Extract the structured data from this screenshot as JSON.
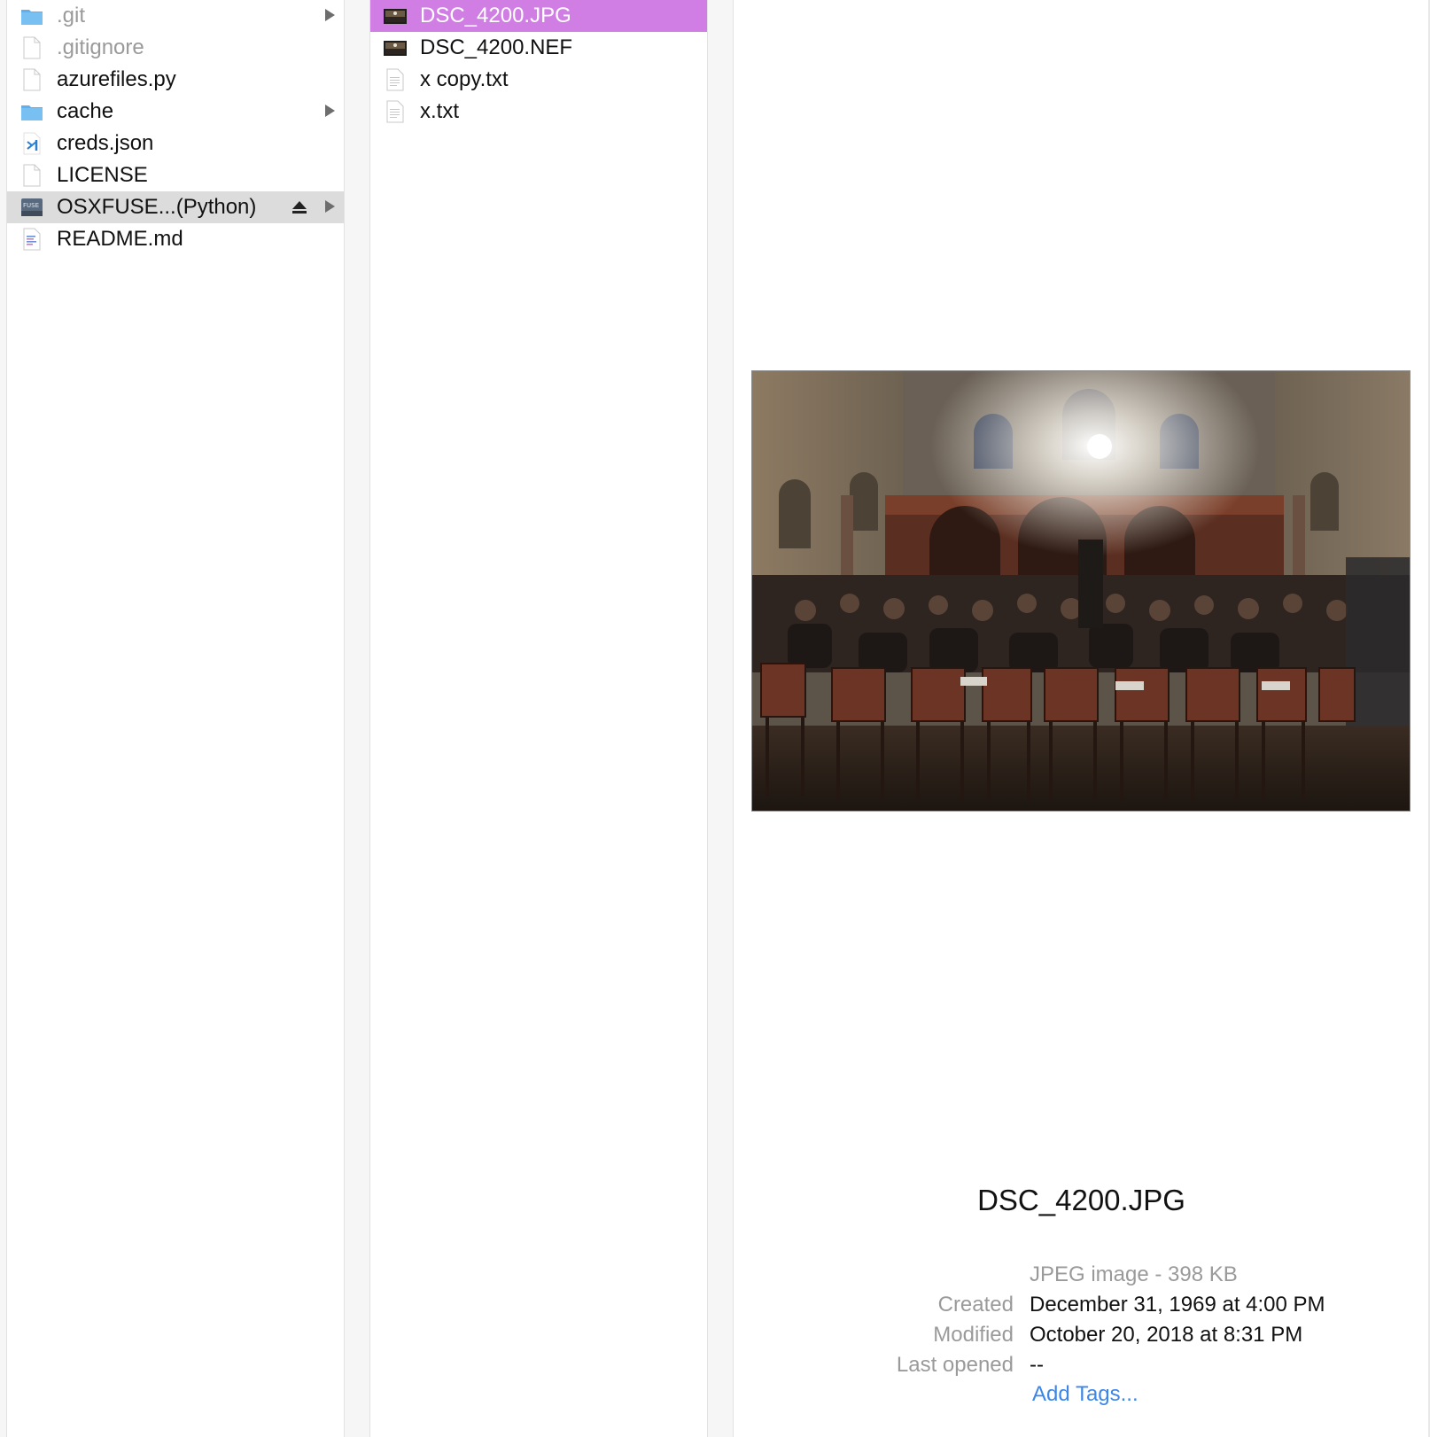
{
  "column1": {
    "items": [
      {
        "label": ".git",
        "icon": "folder-icon",
        "type": "folder",
        "dim": true
      },
      {
        "label": ".gitignore",
        "icon": "document-icon",
        "type": "file",
        "dim": true
      },
      {
        "label": "azurefiles.py",
        "icon": "document-icon",
        "type": "file",
        "dim": false
      },
      {
        "label": "cache",
        "icon": "folder-icon",
        "type": "folder",
        "dim": false
      },
      {
        "label": "creds.json",
        "icon": "vscode-json-icon",
        "type": "file",
        "dim": false
      },
      {
        "label": "LICENSE",
        "icon": "document-icon",
        "type": "file",
        "dim": false
      },
      {
        "label": "OSXFUSE...(Python)",
        "icon": "fuse-volume-icon",
        "type": "volume",
        "dim": false,
        "highlighted": true
      },
      {
        "label": "README.md",
        "icon": "markdown-document-icon",
        "type": "file",
        "dim": false
      }
    ]
  },
  "column2": {
    "items": [
      {
        "label": "DSC_4200.JPG",
        "icon": "image-thumbnail-icon",
        "selected": true
      },
      {
        "label": "DSC_4200.NEF",
        "icon": "image-thumbnail-icon",
        "selected": false
      },
      {
        "label": "x copy.txt",
        "icon": "text-document-icon",
        "selected": false
      },
      {
        "label": "x.txt",
        "icon": "text-document-icon",
        "selected": false
      }
    ]
  },
  "preview": {
    "image_description_icon": "photo-preview",
    "filename": "DSC_4200.JPG",
    "kind_size": "JPEG image - 398 KB",
    "created_label": "Created",
    "created_value": "December 31, 1969 at 4:00 PM",
    "modified_label": "Modified",
    "modified_value": "October 20, 2018 at 8:31 PM",
    "last_opened_label": "Last opened",
    "last_opened_value": "--",
    "add_tags": "Add Tags..."
  },
  "colors": {
    "selection": "#d07ee4",
    "inactive_selection": "#dcdcdc",
    "link": "#3d86e8",
    "folder": "#5fb0ec"
  }
}
